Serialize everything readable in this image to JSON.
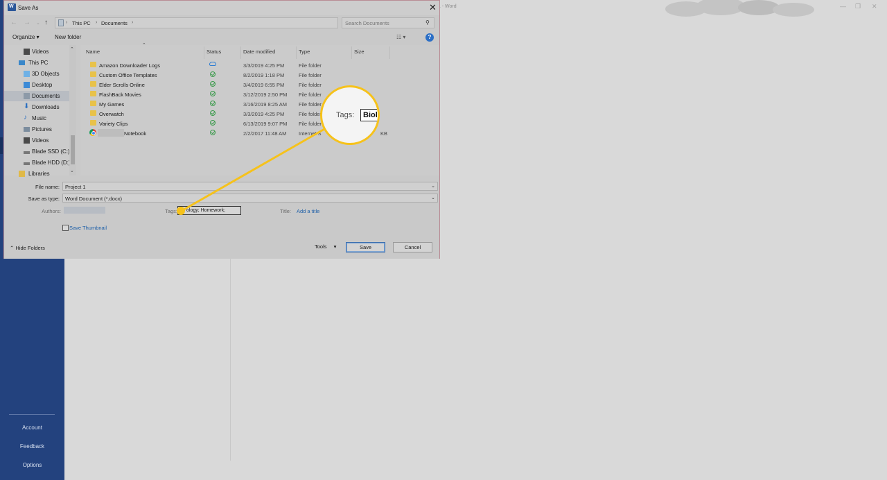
{
  "word": {
    "title_text": "t1 - Word",
    "left_links": [
      "Account",
      "Feedback",
      "Options"
    ]
  },
  "dialog": {
    "title": "Save As",
    "address": [
      "This PC",
      "Documents"
    ],
    "search_placeholder": "Search Documents",
    "toolbar": {
      "organize": "Organize ▾",
      "new_folder": "New folder"
    },
    "nav_items": [
      {
        "label": "Videos",
        "icon": "videos-icon"
      },
      {
        "label": "This PC",
        "icon": "computer-icon"
      },
      {
        "label": "3D Objects",
        "icon": "3d-objects-icon"
      },
      {
        "label": "Desktop",
        "icon": "desktop-icon"
      },
      {
        "label": "Documents",
        "icon": "documents-icon",
        "selected": true
      },
      {
        "label": "Downloads",
        "icon": "downloads-icon"
      },
      {
        "label": "Music",
        "icon": "music-icon"
      },
      {
        "label": "Pictures",
        "icon": "pictures-icon"
      },
      {
        "label": "Videos",
        "icon": "videos-icon"
      },
      {
        "label": "Blade SSD (C:)",
        "icon": "drive-icon"
      },
      {
        "label": "Blade HDD (D:)",
        "icon": "drive-icon"
      },
      {
        "label": "Libraries",
        "icon": "libraries-icon"
      }
    ],
    "columns": {
      "name": "Name",
      "status": "Status",
      "date": "Date modified",
      "type": "Type",
      "size": "Size"
    },
    "files": [
      {
        "name": "Amazon Downloader Logs",
        "status": "cloud",
        "date": "3/3/2019 4:25 PM",
        "type": "File folder",
        "size": ""
      },
      {
        "name": "Custom Office Templates",
        "status": "ok",
        "date": "8/2/2019 1:18 PM",
        "type": "File folder",
        "size": ""
      },
      {
        "name": "Elder Scrolls Online",
        "status": "ok",
        "date": "3/4/2019 6:55 PM",
        "type": "File folder",
        "size": ""
      },
      {
        "name": "FlashBack Movies",
        "status": "ok",
        "date": "3/12/2019 2:50 PM",
        "type": "File folder",
        "size": ""
      },
      {
        "name": "My Games",
        "status": "ok",
        "date": "3/16/2019 8:25 AM",
        "type": "File folder",
        "size": ""
      },
      {
        "name": "Overwatch",
        "status": "ok",
        "date": "3/3/2019 4:25 PM",
        "type": "File folder",
        "size": ""
      },
      {
        "name": "Variety Clips",
        "status": "ok",
        "date": "6/13/2019 9:07 PM",
        "type": "File folder",
        "size": ""
      },
      {
        "name": "Notebook",
        "status": "ok",
        "date": "2/2/2017 11:48 AM",
        "type": "Internet S",
        "size": "KB"
      }
    ],
    "form": {
      "file_name_label": "File name:",
      "file_name_value": "Project 1",
      "save_type_label": "Save as type:",
      "save_type_value": "Word Document (*.docx)",
      "authors_label": "Authors:",
      "tags_label": "Tags:",
      "tags_value": "ology; Homework;",
      "title_label": "Title:",
      "title_value": "Add a title",
      "thumbnail_label": "Save Thumbnail"
    },
    "footer": {
      "hide_folders": "Hide Folders",
      "tools": "Tools",
      "save": "Save",
      "cancel": "Cancel"
    }
  },
  "callout": {
    "label": "Tags:",
    "value": "Biol",
    "color": "#f6c21b"
  }
}
